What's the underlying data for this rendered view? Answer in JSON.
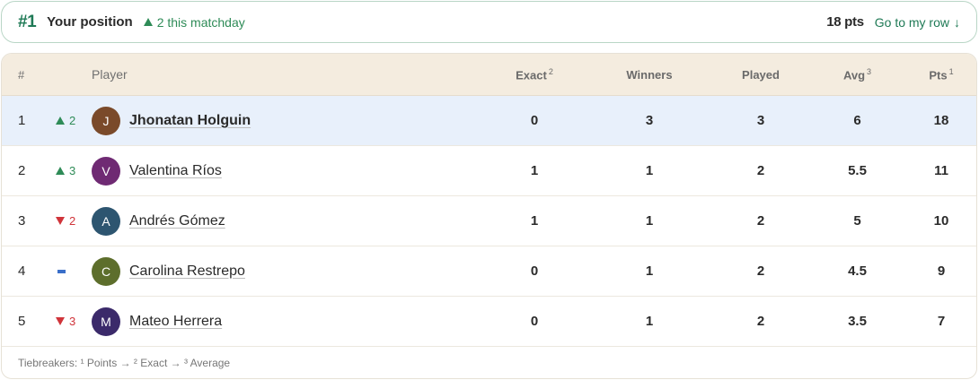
{
  "position": {
    "rank": "#1",
    "label": "Your position",
    "delta": "2 this matchday",
    "points": "18 pts",
    "goto_label": "Go to my row"
  },
  "table": {
    "headers": {
      "rank": "#",
      "player": "Player",
      "exact": "Exact",
      "exact_sup": "2",
      "winners": "Winners",
      "played": "Played",
      "avg": "Avg",
      "avg_sup": "3",
      "pts": "Pts",
      "pts_sup": "1"
    },
    "rows": [
      {
        "rank": "1",
        "move": "up",
        "move_value": "2",
        "initial": "J",
        "avatar_color": "#7a4a2a",
        "name": "Jhonatan Holguin",
        "exact": "0",
        "winners": "3",
        "played": "3",
        "avg": "6",
        "pts": "18"
      },
      {
        "rank": "2",
        "move": "up",
        "move_value": "3",
        "initial": "V",
        "avatar_color": "#6f2a73",
        "name": "Valentina Ríos",
        "exact": "1",
        "winners": "1",
        "played": "2",
        "avg": "5.5",
        "pts": "11"
      },
      {
        "rank": "3",
        "move": "down",
        "move_value": "2",
        "initial": "A",
        "avatar_color": "#2d5570",
        "name": "Andrés Gómez",
        "exact": "1",
        "winners": "1",
        "played": "2",
        "avg": "5",
        "pts": "10"
      },
      {
        "rank": "4",
        "move": "same",
        "move_value": "",
        "initial": "C",
        "avatar_color": "#5d6e2c",
        "name": "Carolina Restrepo",
        "exact": "0",
        "winners": "1",
        "played": "2",
        "avg": "4.5",
        "pts": "9"
      },
      {
        "rank": "5",
        "move": "down",
        "move_value": "3",
        "initial": "M",
        "avatar_color": "#3b2a6a",
        "name": "Mateo Herrera",
        "exact": "0",
        "winners": "1",
        "played": "2",
        "avg": "3.5",
        "pts": "7"
      }
    ],
    "footnote": "Tiebreakers: ¹ Points → ² Exact → ³ Average"
  },
  "colors": {
    "accent": "#1f7a56",
    "up": "#2e8b57",
    "down": "#d0343a",
    "same": "#3a6fc9",
    "highlight_row": "#e8f0fb",
    "header_bg": "#f4ecdf"
  }
}
